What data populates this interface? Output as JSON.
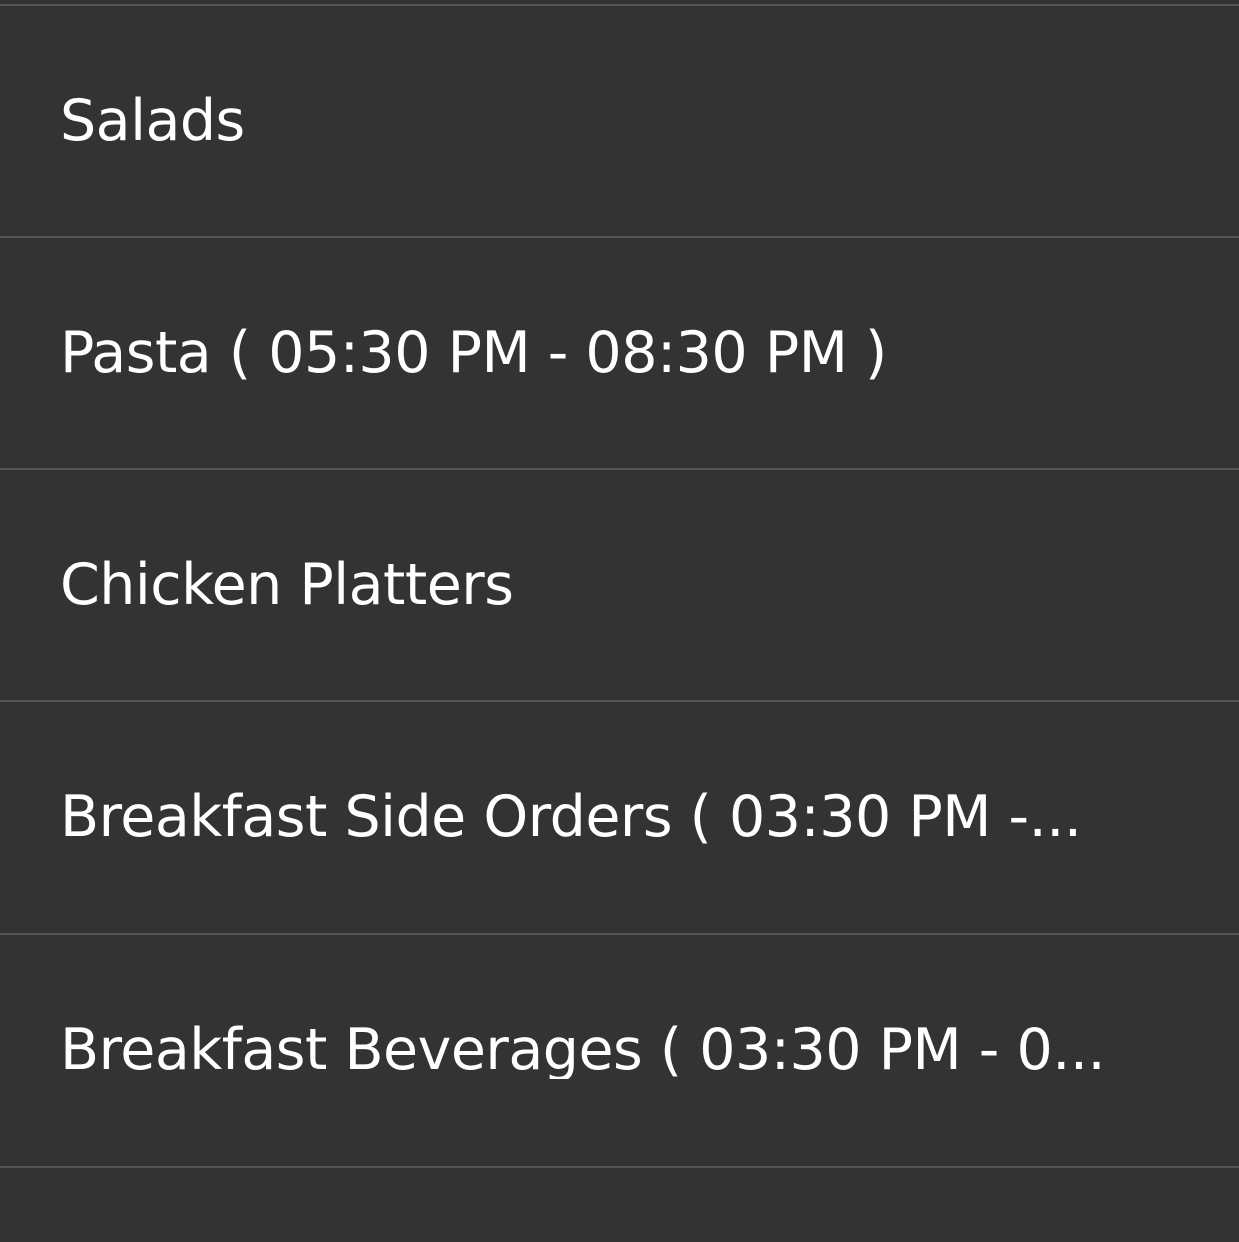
{
  "menu": {
    "categories": [
      {
        "label": "Salads"
      },
      {
        "label": "Pasta ( 05:30 PM - 08:30 PM )"
      },
      {
        "label": "Chicken Platters"
      },
      {
        "label": "Breakfast Side Orders ( 03:30 PM -..."
      },
      {
        "label": "Breakfast Beverages ( 03:30 PM - 0..."
      }
    ]
  },
  "colors": {
    "background": "#333333",
    "divider": "#555555",
    "text": "#ffffff"
  }
}
